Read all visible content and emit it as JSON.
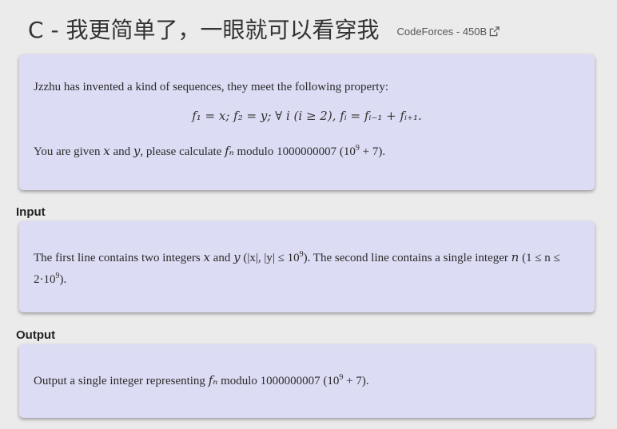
{
  "header": {
    "title": "C - 我更简单了，一眼就可以看穿我",
    "source_link": "CodeForces - 450B",
    "source_icon": "external-link-icon"
  },
  "statement": {
    "intro": "Jzzhu has invented a kind of sequences, they meet the following property:",
    "formula": "f₁ = x;  f₂ = y;  ∀ i (i ≥ 2), fᵢ = fᵢ₋₁ + fᵢ₊₁.",
    "task_pre": "You are given",
    "var_x": "x",
    "and": "and",
    "var_y": "y",
    "task_mid": ", please calculate",
    "var_fn": "fₙ",
    "task_mod": "modulo 1000000007 (10",
    "exp9": "9",
    "task_end": "+ 7)."
  },
  "input": {
    "label": "Input",
    "pre": "The first line contains two integers",
    "var_x": "x",
    "and": "and",
    "var_y": "y",
    "abs_part": "(|x|, |y| ≤ 10",
    "exp9": "9",
    "mid": "). The second line contains a single integer",
    "var_n": "n",
    "range_start": "(1",
    "range_rest": "≤ n ≤ 2·10",
    "exp9b": "9",
    "end": ")."
  },
  "output": {
    "label": "Output",
    "pre": "Output a single integer representing",
    "var_fn": "fₙ",
    "mod": "modulo 1000000007 (10",
    "exp9": "9",
    "end": "+ 7)."
  },
  "colors": {
    "background": "#ebebeb",
    "card": "#dcdcf4"
  }
}
